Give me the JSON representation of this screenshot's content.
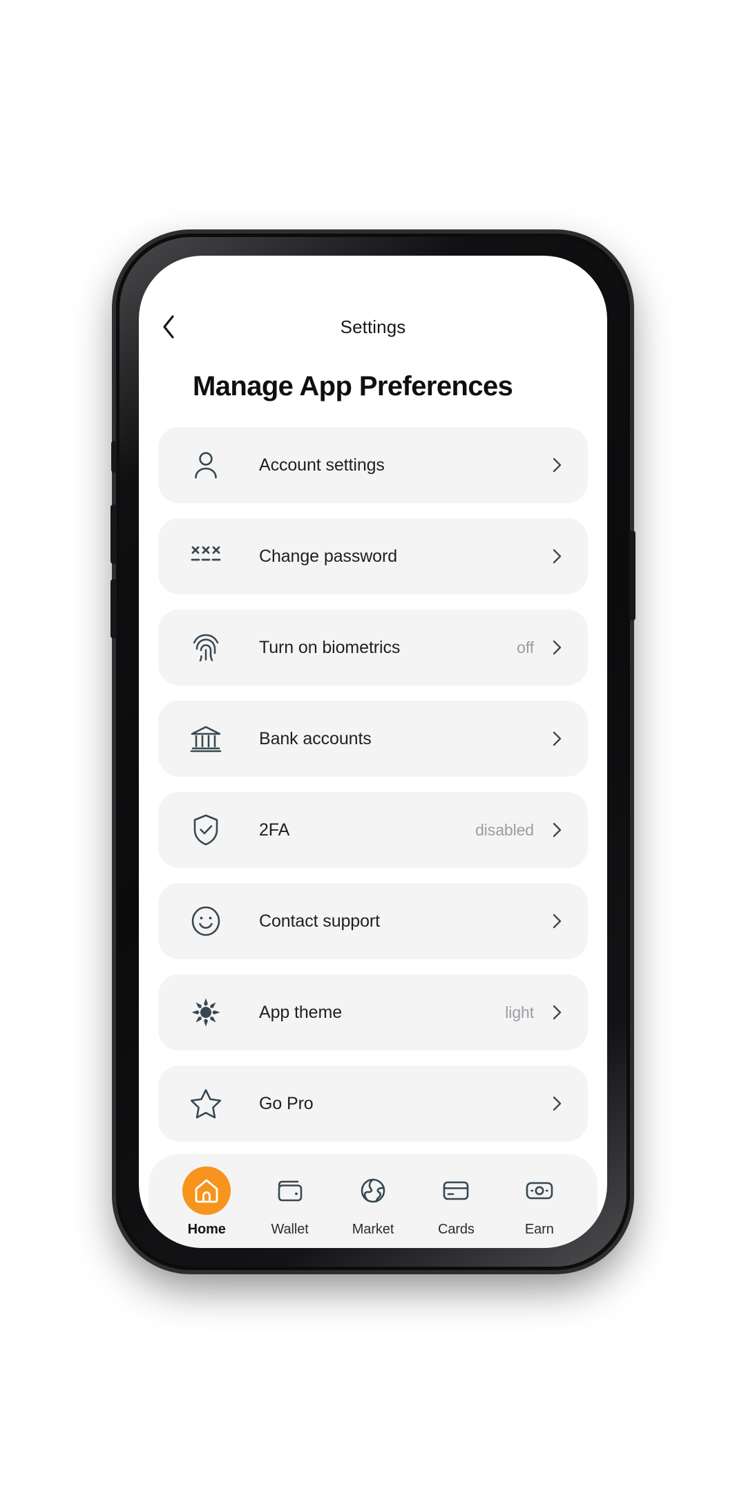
{
  "header": {
    "back_icon": "chevron-left-icon",
    "title": "Settings"
  },
  "page_title": "Manage App Preferences",
  "settings_rows": [
    {
      "icon": "user-icon",
      "label": "Account settings",
      "value": "",
      "chevron": "chevron-right-icon"
    },
    {
      "icon": "password-icon",
      "label": "Change password",
      "value": "",
      "chevron": "chevron-right-icon"
    },
    {
      "icon": "fingerprint-icon",
      "label": "Turn on biometrics",
      "value": "off",
      "chevron": "chevron-right-icon"
    },
    {
      "icon": "bank-icon",
      "label": "Bank accounts",
      "value": "",
      "chevron": "chevron-right-icon"
    },
    {
      "icon": "shield-check-icon",
      "label": "2FA",
      "value": "disabled",
      "chevron": "chevron-right-icon"
    },
    {
      "icon": "smiley-icon",
      "label": "Contact support",
      "value": "",
      "chevron": "chevron-right-icon"
    },
    {
      "icon": "sun-icon",
      "label": "App theme",
      "value": "light",
      "chevron": "chevron-right-icon"
    },
    {
      "icon": "star-icon",
      "label": "Go Pro",
      "value": "",
      "chevron": "chevron-right-icon"
    }
  ],
  "tabbar": {
    "active": "Home",
    "items": [
      {
        "icon": "home-icon",
        "label": "Home"
      },
      {
        "icon": "wallet-icon",
        "label": "Wallet"
      },
      {
        "icon": "globe-icon",
        "label": "Market"
      },
      {
        "icon": "card-icon",
        "label": "Cards"
      },
      {
        "icon": "banknote-icon",
        "label": "Earn"
      }
    ]
  },
  "colors": {
    "accent": "#F7941D",
    "row_bg": "#f4f4f5",
    "icon": "#37474f",
    "value_text": "#9a9da2"
  }
}
